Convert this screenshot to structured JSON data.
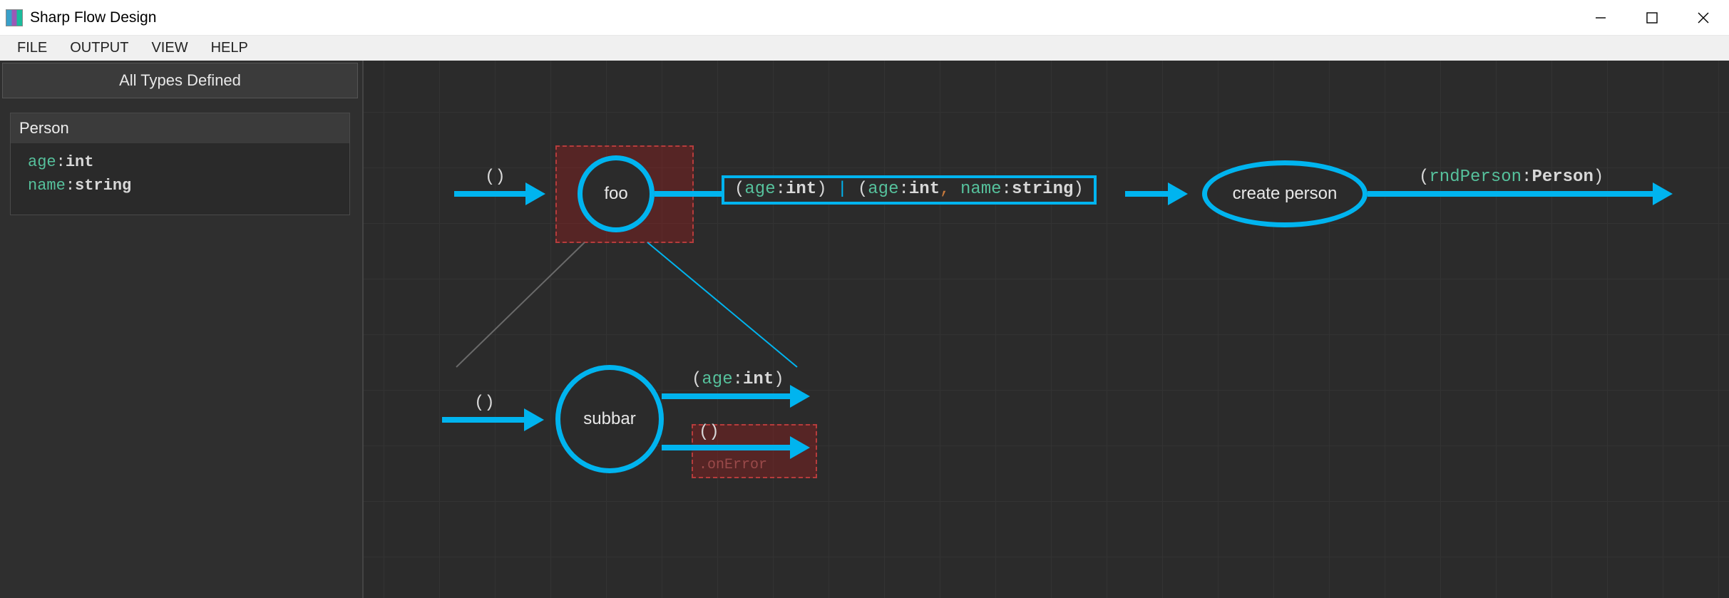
{
  "window": {
    "title": "Sharp Flow Design"
  },
  "menu": {
    "file": "FILE",
    "output": "OUTPUT",
    "view": "VIEW",
    "help": "HELP"
  },
  "sidebar": {
    "header": "All Types Defined",
    "types": [
      {
        "name": "Person",
        "fields": [
          {
            "name": "age",
            "type": "int"
          },
          {
            "name": "name",
            "type": "string"
          }
        ]
      }
    ]
  },
  "canvas": {
    "nodes": {
      "foo": {
        "label": "foo",
        "selected": true
      },
      "subbar": {
        "label": "subbar",
        "selected": false
      },
      "createPerson": {
        "label": "create person",
        "selected": false
      }
    },
    "ports": {
      "foo_in": "()",
      "foo_out_sig": {
        "alt1": {
          "params": [
            {
              "name": "age",
              "type": "int"
            }
          ]
        },
        "alt2": {
          "params": [
            {
              "name": "age",
              "type": "int"
            },
            {
              "name": "name",
              "type": "string"
            }
          ]
        }
      },
      "createPerson_out": {
        "params": [
          {
            "name": "rndPerson",
            "type": "Person"
          }
        ]
      },
      "subbar_in": "()",
      "subbar_out_top": {
        "params": [
          {
            "name": "age",
            "type": "int"
          }
        ]
      },
      "subbar_out_err_sig": "()",
      "subbar_out_err_lbl": ".onError"
    },
    "colors": {
      "accent": "#00b4ef",
      "error": "#b63c3c",
      "param": "#56c19c"
    }
  }
}
